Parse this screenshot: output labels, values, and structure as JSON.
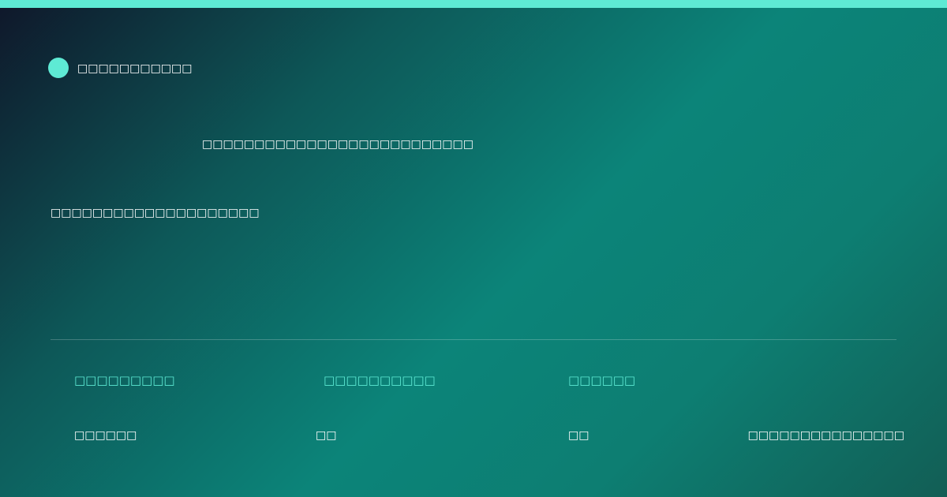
{
  "brand": {
    "name": "□□□□□□□□□□□"
  },
  "hero": {
    "headline": "□□□□□□□□□□□□□□□□□□□□□□□□□□",
    "subtitle": "□□□□□□□□□□□□□□□□□□□□"
  },
  "stats": [
    {
      "label": "□□□□□□□□□",
      "value": "□□□□□□"
    },
    {
      "label": "□□□□□□□□□□",
      "value": "□□"
    },
    {
      "label": "□□□□□□",
      "value": "□□"
    }
  ],
  "footer": {
    "note": "□□□□□□□□□□□□□□□"
  },
  "colors": {
    "accent": "#5eead4",
    "gradient_start": "#0f172a",
    "gradient_mid": "#0c8479",
    "gradient_end": "#125e55"
  }
}
